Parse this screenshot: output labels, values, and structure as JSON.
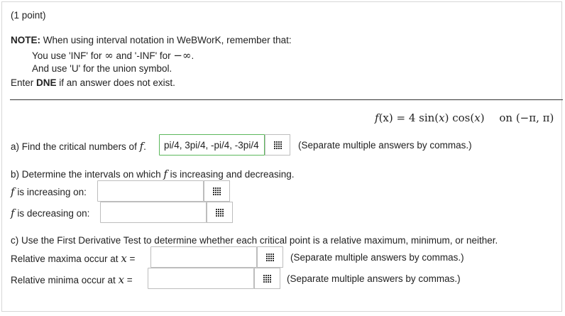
{
  "header": {
    "points": "(1 point)"
  },
  "note": {
    "label": "NOTE:",
    "text": " When using interval notation in WeBWorK, remember that:",
    "line1_a": "You use 'INF' for ",
    "line1_inf": "∞",
    "line1_b": " and '-INF' for ",
    "line1_neginf": "−∞",
    "line1_c": ".",
    "line2": "And use 'U' for the union symbol.",
    "dne_a": "Enter ",
    "dne_b": "DNE",
    "dne_c": " if an answer does not exist."
  },
  "function": {
    "f": "f",
    "arg": "(x) = 4 sin(",
    "x1": "x",
    "mid": ") cos(",
    "x2": "x",
    "end": ")",
    "on": "on",
    "interval": "(−π, π)"
  },
  "part_a": {
    "label_a": "a) Find the critical numbers of ",
    "label_f": "f",
    "label_end": ".",
    "value": "pi/4, 3pi/4, -pi/4, -3pi/4",
    "hint": "(Separate multiple answers by commas.)"
  },
  "part_b": {
    "label_a": "b) Determine the intervals on which ",
    "label_f": "f",
    "label_b": " is increasing and decreasing.",
    "inc_f": "f",
    "inc_label": " is increasing on:",
    "inc_value": "",
    "dec_f": "f",
    "dec_label": " is decreasing on:",
    "dec_value": ""
  },
  "part_c": {
    "label": "c) Use the First Derivative Test to determine whether each critical point is a relative maximum, minimum, or neither.",
    "max_label": "Relative maxima occur at ",
    "max_x": "x",
    "max_eq": " =",
    "max_value": "",
    "max_hint": "(Separate multiple answers by commas.)",
    "min_label": "Relative minima occur at ",
    "min_x": "x",
    "min_eq": " =",
    "min_value": "",
    "min_hint": "(Separate multiple answers by commas.)"
  },
  "colors": {
    "filled_border": "#5cb85c",
    "rule": "#333333",
    "text": "#222222"
  },
  "icons": {
    "palette": "grid-icon"
  }
}
